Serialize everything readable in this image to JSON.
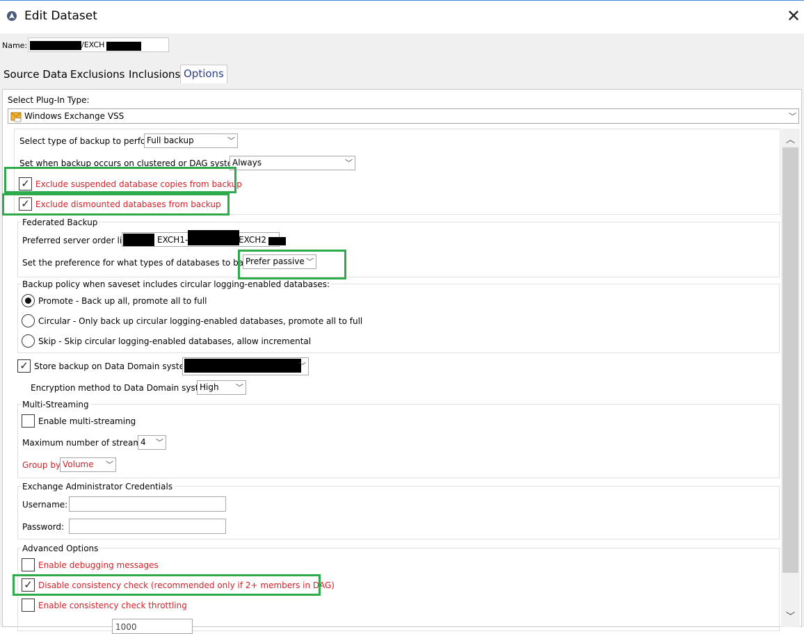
{
  "window": {
    "title": "Edit Dataset"
  },
  "name_field": {
    "label": "Name:",
    "value_visible": "/EXCH"
  },
  "tabs": [
    {
      "label": "Source Data"
    },
    {
      "label": "Exclusions"
    },
    {
      "label": "Inclusions"
    },
    {
      "label": "Options",
      "active": true
    }
  ],
  "plugin": {
    "label": "Select Plug-In Type:",
    "value": "Windows Exchange VSS"
  },
  "backup_type": {
    "label": "Select type of backup to perform",
    "value": "Full backup"
  },
  "clustered": {
    "label": "Set when backup occurs on clustered or DAG systems",
    "value": "Always"
  },
  "exclude_suspended": {
    "label": "Exclude suspended database copies from backup",
    "checked": true
  },
  "exclude_dismounted": {
    "label": "Exclude dismounted databases from backup",
    "checked": true
  },
  "federated": {
    "title": "Federated Backup",
    "server_order_label": "Preferred server order list",
    "server_part1": "EXCH1-",
    "server_part2": "EXCH2",
    "preference_label": "Set the preference for what types of databases to back up",
    "preference_value": "Prefer passive"
  },
  "circular": {
    "title": "Backup policy when saveset includes circular logging-enabled databases:",
    "options": [
      {
        "label": "Promote - Back up all, promote all to full",
        "selected": true
      },
      {
        "label": "Circular - Only back up circular logging-enabled databases, promote all to full",
        "selected": false
      },
      {
        "label": "Skip - Skip circular logging-enabled databases, allow incremental",
        "selected": false
      }
    ]
  },
  "data_domain": {
    "label": "Store backup on Data Domain system",
    "checked": true
  },
  "encryption": {
    "label": "Encryption method to Data Domain system",
    "value": "High"
  },
  "multistream": {
    "title": "Multi-Streaming",
    "enable_label": "Enable multi-streaming",
    "enable_checked": false,
    "max_label": "Maximum number of streams",
    "max_value": "4",
    "group_label": "Group by",
    "group_value": "Volume"
  },
  "credentials": {
    "title": "Exchange Administrator Credentials",
    "username_label": "Username:",
    "password_label": "Password:"
  },
  "advanced": {
    "title": "Advanced Options",
    "debug_label": "Enable debugging messages",
    "debug_checked": false,
    "consistency_label": "Disable consistency check (recommended only if 2+ members in DAG)",
    "consistency_checked": true,
    "throttle_label": "Enable consistency check throttling",
    "throttle_checked": false,
    "cut_value": "1000"
  },
  "colors": {
    "highlight": "#2daa4a",
    "red_text": "#d31f26",
    "active_tab": "#2d3d8f"
  }
}
